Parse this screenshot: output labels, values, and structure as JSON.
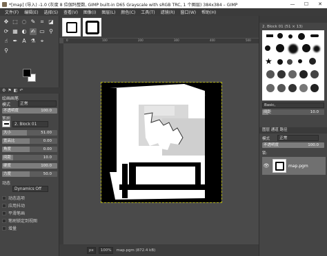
{
  "window": {
    "title": "*[map] (导入) -1.0 (灰度 8 位伽玛整数, GIMP built-in D65 Grayscale with sRGB TRC, 1 个图层) 384x384 – GIMP",
    "controls": [
      "—",
      "☐",
      "✕"
    ]
  },
  "menu": [
    "文件(F)",
    "编辑(E)",
    "选择(S)",
    "查看(V)",
    "图像(I)",
    "图层(L)",
    "颜色(C)",
    "工具(T)",
    "滤镜(R)",
    "窗口(W)",
    "帮助(H)"
  ],
  "tool_options": {
    "tabs": [
      "⚙",
      "⚑",
      "◧",
      "↶"
    ],
    "title": "绘画画笔",
    "mode_label": "模式",
    "mode_value": "正常",
    "opacity_label": "不透明度",
    "opacity_value": "100.0",
    "brush_label": "笔刷",
    "brush_value": "2. Block 01",
    "sliders": [
      {
        "label": "大小",
        "value": "51.00"
      },
      {
        "label": "宽高比",
        "value": "0.00"
      },
      {
        "label": "角度",
        "value": "0.00"
      },
      {
        "label": "间距",
        "value": "10.0"
      },
      {
        "label": "硬度",
        "value": "100.0"
      },
      {
        "label": "力度",
        "value": "50.0"
      }
    ],
    "dynamics_label": "动态",
    "dynamics_value": "Dynamics Off",
    "checks": [
      "动态选项",
      "应用抖动",
      "平滑笔画",
      "笔刷锁定到视图",
      "增量"
    ]
  },
  "canvas": {
    "ruler_ticks": [
      "0",
      "100",
      "200",
      "300",
      "400",
      "500"
    ],
    "bg_color": "#000000",
    "fg_color": "#ffffff"
  },
  "status": {
    "unit": "px",
    "zoom": "100%",
    "file": "map.pgm (872.4 kB)"
  },
  "right_panel": {
    "brush_subtitle": "2. Block 01 (51 × 13)",
    "tag_filter": "Basic,",
    "spacing_label": "间距",
    "spacing_value": "10.0",
    "layers_tabs": "图层  通道  路径",
    "mode_label": "模式",
    "mode_value": "正常",
    "opacity_label": "不透明度",
    "opacity_value": "100.0",
    "lock_label": "锁:",
    "layer_name": "map.pgm"
  }
}
